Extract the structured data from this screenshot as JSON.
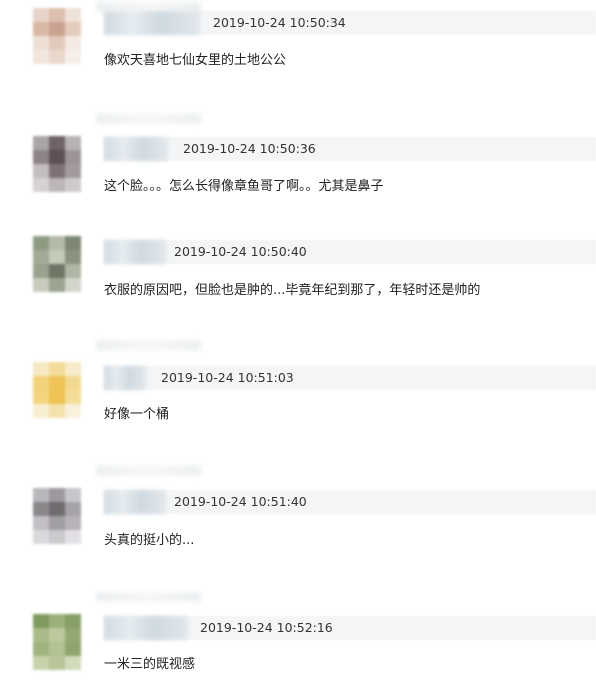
{
  "comments": [
    {
      "timestamp": "2019-10-24 10:50:34",
      "text": "像欢天喜地七仙女里的土地公公",
      "avatar_colors": [
        "#e8d3c8",
        "#dcbfae",
        "#f0e2d8",
        "#d9b8a5",
        "#c9a390",
        "#e3ccbe",
        "#efe0d6",
        "#e2cabb",
        "#f4eae3",
        "#f2e6dd",
        "#ead8cc",
        "#f6eee8"
      ]
    },
    {
      "timestamp": "2019-10-24 10:50:36",
      "text": "这个脸。。。怎么长得像章鱼哥了啊。。尤其是鼻子",
      "avatar_colors": [
        "#a9a4a8",
        "#6f6367",
        "#b8b2b5",
        "#8e8487",
        "#5c4f55",
        "#9d9498",
        "#c4bec1",
        "#7d7175",
        "#a49a9e",
        "#d6d1d3",
        "#bdb6b9",
        "#cfcacc"
      ]
    },
    {
      "timestamp": "2019-10-24 10:50:40",
      "text": "衣服的原因吧，但脸也是肿的...毕竟年纪到那了，年轻时还是帅的",
      "avatar_colors": [
        "#8f9a83",
        "#b4bba8",
        "#7d8773",
        "#a1aa94",
        "#c5cab9",
        "#8a9380",
        "#9aa28d",
        "#6e7765",
        "#b0b6a4",
        "#c8ccbd",
        "#9da592",
        "#d3d6ca"
      ]
    },
    {
      "timestamp": "2019-10-24 10:51:03",
      "text": "好像一个桶",
      "avatar_colors": [
        "#f6e9c4",
        "#f3dc9a",
        "#f7ebc9",
        "#f2d27a",
        "#efc357",
        "#f3d98f",
        "#f4d57f",
        "#eec253",
        "#f5dd97",
        "#f8efd3",
        "#f4e2ad",
        "#f9f1dc"
      ]
    },
    {
      "timestamp": "2019-10-24 10:51:40",
      "text": "头真的挺小的...",
      "avatar_colors": [
        "#b9b7ba",
        "#9c999d",
        "#c8c6c9",
        "#8a878b",
        "#6f6c70",
        "#a6a3a7",
        "#c2bfc3",
        "#a29fa3",
        "#b6b3b7",
        "#dad8db",
        "#cbc9cc",
        "#e2e0e3"
      ]
    },
    {
      "timestamp": "2019-10-24 10:52:16",
      "text": "一米三的既视感",
      "avatar_colors": [
        "#7f9a5f",
        "#9bb07b",
        "#86a066",
        "#a9bb88",
        "#bcc99d",
        "#93a972",
        "#9fb37f",
        "#b3c393",
        "#8ea66c",
        "#c7d2ab",
        "#b8c69a",
        "#d2dbbb"
      ]
    }
  ]
}
